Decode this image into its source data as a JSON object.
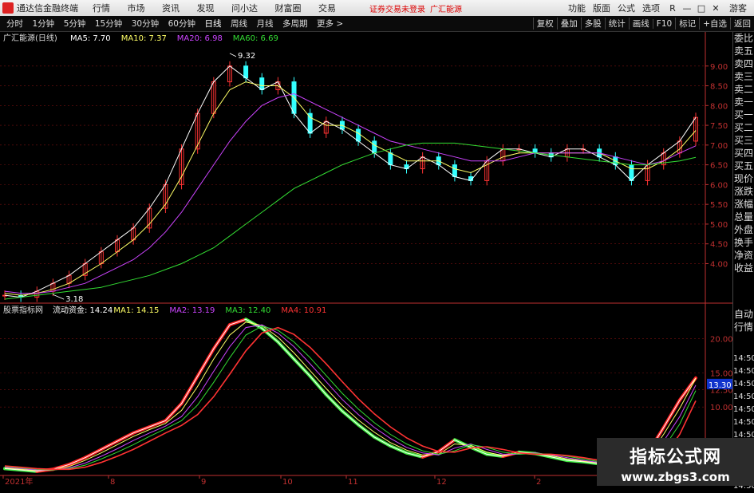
{
  "app": {
    "name": "通达信金融终端"
  },
  "menu": [
    "行情",
    "市场",
    "资讯",
    "发现",
    "问小达",
    "财富圈",
    "交易"
  ],
  "notice": "证券交易未登录",
  "stock_name_top": "广汇能源",
  "right_menu": [
    "功能",
    "版面",
    "公式",
    "选项"
  ],
  "window_buttons": [
    "R",
    "—",
    "□",
    "✕"
  ],
  "guest": "游客",
  "periods": [
    "分时",
    "1分钟",
    "5分钟",
    "15分钟",
    "30分钟",
    "60分钟",
    "日线",
    "周线",
    "月线",
    "多周期",
    "更多 >"
  ],
  "tools": [
    "复权",
    "叠加",
    "多股",
    "统计",
    "画线",
    "F10",
    "标记",
    "+自选",
    "返回"
  ],
  "main_legend": {
    "title": "广汇能源(日线)",
    "items": [
      {
        "label": "MA5: 7.70",
        "color": "#ffffff"
      },
      {
        "label": "MA10: 7.37",
        "color": "#ffff66"
      },
      {
        "label": "MA20: 6.98",
        "color": "#cc44ff"
      },
      {
        "label": "MA60: 6.69",
        "color": "#33dd33"
      }
    ]
  },
  "sub_legend": {
    "title": "股票指标网",
    "items": [
      {
        "label": "流动资金: 14.24",
        "color": "#ffffff"
      },
      {
        "label": "MA1: 14.15",
        "color": "#ffff66"
      },
      {
        "label": "MA2: 13.19",
        "color": "#cc44ff"
      },
      {
        "label": "MA3: 12.40",
        "color": "#33dd33"
      },
      {
        "label": "MA4: 10.91",
        "color": "#ff3333"
      }
    ]
  },
  "colors": {
    "up": "#ff3333",
    "down": "#33ffff",
    "grid": "#7a1010",
    "axis": "#c03030"
  },
  "chart_data": [
    {
      "type": "candlestick",
      "title": "广汇能源(日线)",
      "y_ticks": [
        "9.00",
        "8.50",
        "8.00",
        "7.50",
        "7.00",
        "6.50",
        "6.00",
        "5.50",
        "5.00",
        "4.50",
        "4.00"
      ],
      "ylim": [
        3.0,
        9.5
      ],
      "annotations": [
        {
          "label": "9.32",
          "value": 9.32
        },
        {
          "label": "3.18",
          "value": 3.18
        }
      ],
      "series": [
        {
          "name": "MA5",
          "values": [
            3.2,
            3.15,
            3.3,
            3.5,
            3.7,
            4.0,
            4.3,
            4.6,
            4.9,
            5.4,
            6.0,
            6.9,
            7.8,
            8.6,
            9.0,
            8.7,
            8.4,
            8.6,
            7.8,
            7.3,
            7.6,
            7.4,
            7.1,
            6.8,
            6.5,
            6.4,
            6.7,
            6.5,
            6.2,
            6.1,
            6.6,
            6.9,
            6.9,
            6.8,
            6.7,
            6.9,
            6.9,
            6.7,
            6.5,
            6.1,
            6.5,
            6.8,
            7.1,
            7.7
          ]
        },
        {
          "name": "MA10",
          "values": [
            3.25,
            3.2,
            3.25,
            3.35,
            3.5,
            3.75,
            4.0,
            4.3,
            4.6,
            5.0,
            5.5,
            6.2,
            7.0,
            7.8,
            8.4,
            8.6,
            8.5,
            8.5,
            8.2,
            7.7,
            7.5,
            7.5,
            7.3,
            7.0,
            6.8,
            6.6,
            6.6,
            6.6,
            6.4,
            6.3,
            6.5,
            6.7,
            6.8,
            6.8,
            6.8,
            6.8,
            6.8,
            6.8,
            6.6,
            6.4,
            6.4,
            6.6,
            6.9,
            7.37
          ]
        },
        {
          "name": "MA20",
          "values": [
            3.3,
            3.25,
            3.25,
            3.3,
            3.4,
            3.5,
            3.7,
            3.9,
            4.1,
            4.4,
            4.8,
            5.3,
            5.9,
            6.5,
            7.1,
            7.6,
            8.0,
            8.2,
            8.3,
            8.1,
            7.9,
            7.7,
            7.5,
            7.3,
            7.1,
            7.0,
            6.9,
            6.8,
            6.7,
            6.6,
            6.6,
            6.6,
            6.7,
            6.8,
            6.8,
            6.8,
            6.8,
            6.8,
            6.7,
            6.6,
            6.5,
            6.6,
            6.8,
            6.98
          ]
        },
        {
          "name": "MA60",
          "values": [
            3.1,
            3.15,
            3.2,
            3.25,
            3.3,
            3.35,
            3.4,
            3.5,
            3.6,
            3.7,
            3.85,
            4.0,
            4.2,
            4.4,
            4.7,
            5.0,
            5.3,
            5.6,
            5.9,
            6.1,
            6.3,
            6.5,
            6.65,
            6.8,
            6.9,
            7.0,
            7.05,
            7.05,
            7.05,
            7.0,
            6.95,
            6.9,
            6.85,
            6.8,
            6.75,
            6.7,
            6.65,
            6.6,
            6.55,
            6.5,
            6.5,
            6.55,
            6.6,
            6.69
          ]
        }
      ]
    },
    {
      "type": "line",
      "title": "股票指标网",
      "y_ticks": [
        "20.00",
        "15.00",
        "12.50",
        "10.00"
      ],
      "current_label": "13.30",
      "x_ticks": [
        "2021年",
        "8",
        "9",
        "10",
        "11",
        "12",
        "2"
      ],
      "series": [
        {
          "name": "流动资金",
          "values": [
            1.0,
            0.8,
            0.6,
            0.9,
            1.6,
            2.6,
            3.8,
            5.0,
            6.2,
            7.1,
            8.0,
            10.5,
            14.5,
            18.5,
            22.0,
            22.8,
            21.5,
            19.5,
            17.0,
            14.5,
            11.8,
            9.4,
            7.4,
            5.6,
            4.3,
            3.3,
            2.7,
            3.5,
            5.2,
            4.1,
            3.1,
            2.8,
            3.4,
            3.2,
            2.7,
            2.2,
            2.0,
            1.7,
            1.4,
            1.3,
            3.2,
            7.0,
            11.0,
            14.24
          ]
        },
        {
          "name": "MA1",
          "values": [
            1.1,
            0.9,
            0.7,
            0.8,
            1.3,
            2.2,
            3.3,
            4.5,
            5.7,
            6.7,
            7.6,
            9.5,
            13.0,
            17.0,
            20.5,
            22.4,
            21.9,
            20.2,
            17.9,
            15.3,
            12.7,
            10.2,
            8.1,
            6.3,
            4.8,
            3.7,
            3.0,
            3.1,
            4.6,
            4.4,
            3.4,
            2.9,
            3.2,
            3.3,
            2.9,
            2.4,
            2.1,
            1.8,
            1.5,
            1.35,
            2.6,
            6.0,
            9.8,
            14.15
          ]
        },
        {
          "name": "MA2",
          "values": [
            1.2,
            1.0,
            0.8,
            0.8,
            1.1,
            1.8,
            2.8,
            3.9,
            5.1,
            6.2,
            7.2,
            8.6,
            11.5,
            15.2,
            18.8,
            21.6,
            22.0,
            20.8,
            18.8,
            16.3,
            13.7,
            11.1,
            8.9,
            7.0,
            5.4,
            4.1,
            3.3,
            3.0,
            4.0,
            4.6,
            3.8,
            3.1,
            3.1,
            3.3,
            3.0,
            2.6,
            2.2,
            1.9,
            1.6,
            1.4,
            2.0,
            5.0,
            8.6,
            13.19
          ]
        },
        {
          "name": "MA3",
          "values": [
            1.3,
            1.1,
            0.9,
            0.8,
            1.0,
            1.5,
            2.4,
            3.4,
            4.5,
            5.7,
            6.8,
            8.0,
            10.3,
            13.6,
            17.2,
            20.5,
            21.8,
            21.2,
            19.5,
            17.2,
            14.6,
            12.0,
            9.7,
            7.7,
            6.0,
            4.6,
            3.6,
            3.1,
            3.6,
            4.5,
            4.1,
            3.4,
            3.1,
            3.2,
            3.1,
            2.8,
            2.4,
            2.0,
            1.7,
            1.5,
            1.7,
            4.0,
            7.5,
            12.4
          ]
        },
        {
          "name": "MA4",
          "values": [
            1.4,
            1.2,
            1.0,
            0.9,
            0.9,
            1.2,
            1.9,
            2.8,
            3.8,
            5.0,
            6.2,
            7.3,
            8.9,
            11.5,
            14.8,
            18.2,
            20.8,
            21.6,
            20.6,
            18.7,
            16.3,
            13.7,
            11.2,
            9.0,
            7.1,
            5.5,
            4.3,
            3.5,
            3.4,
            4.0,
            4.2,
            3.8,
            3.3,
            3.1,
            3.1,
            2.9,
            2.6,
            2.2,
            1.9,
            1.6,
            1.5,
            2.8,
            6.0,
            10.91
          ]
        }
      ]
    }
  ]
}
